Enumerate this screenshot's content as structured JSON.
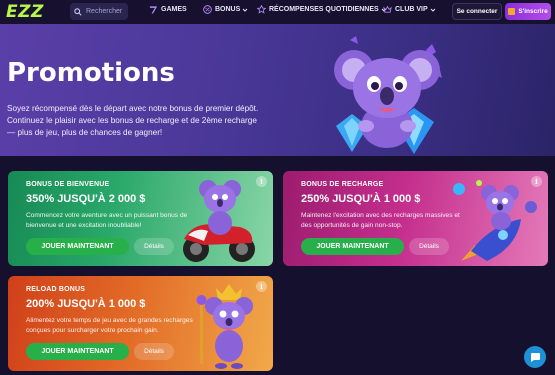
{
  "header": {
    "logo": "EZZ",
    "search_placeholder": "Rechercher",
    "nav": [
      {
        "label": "GAMES",
        "icon": "seven-icon"
      },
      {
        "label": "BONUS",
        "icon": "percent-badge-icon"
      },
      {
        "label": "RÉCOMPENSES QUOTIDIENNES",
        "icon": "star-icon"
      },
      {
        "label": "CLUB VIP",
        "icon": "crown-icon"
      }
    ],
    "login_label": "Se connecter",
    "signup_label": "S'inscrire"
  },
  "hero": {
    "title": "Promotions",
    "description": "Soyez récompensé dès le départ avec notre bonus de premier dépôt. Continuez le plaisir avec les bonus de recharge et de 2ème recharge — plus de jeu, plus de chances de gagner!"
  },
  "cards": [
    {
      "title": "BONUS DE BIENVENUE",
      "amount": "350% JUSQU'À 2 000 $",
      "description": "Commencez votre aventure avec un puissant bonus de bienvenue et une excitation inoubliable!",
      "play_label": "JOUER MAINTENANT",
      "details_label": "Détails",
      "info": "i"
    },
    {
      "title": "BONUS DE RECHARGE",
      "amount": "250% JUSQU'À 1 000 $",
      "description": "Maintenez l'excitation avec des recharges massives et des opportunités de gain non-stop.",
      "play_label": "JOUER MAINTENANT",
      "details_label": "Détails",
      "info": "i"
    },
    {
      "title": "RELOAD BONUS",
      "amount": "200% JUSQU'À 1 000 $",
      "description": "Alimentez votre temps de jeu avec de grandes recharges conçues pour surcharger votre prochain gain.",
      "play_label": "JOUER MAINTENANT",
      "details_label": "Détails",
      "info": "i"
    }
  ],
  "colors": {
    "brand_green": "#b7f64a",
    "signup_purple": "#a03fe2",
    "play_green": "#27b04a",
    "chat_blue": "#1f8fd6"
  }
}
